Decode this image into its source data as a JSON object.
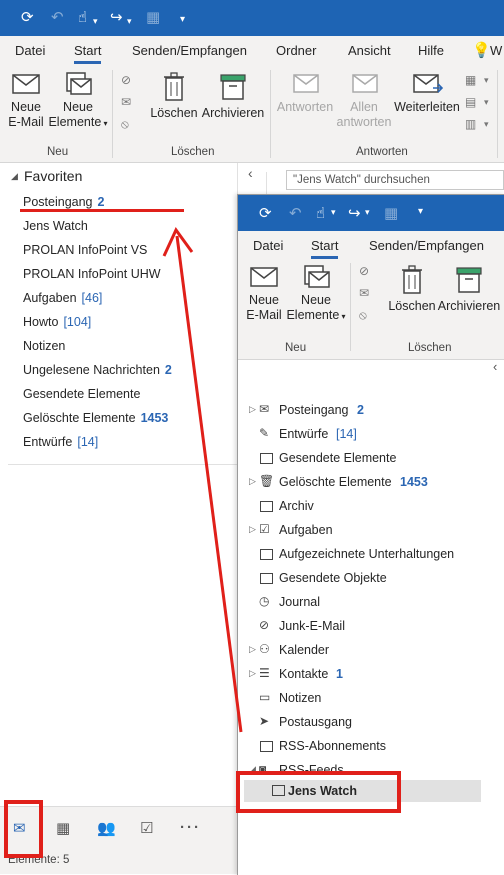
{
  "main": {
    "tabs": [
      "Datei",
      "Start",
      "Senden/Empfangen",
      "Ordner",
      "Ansicht",
      "Hilfe"
    ],
    "ribbon": {
      "new_email": "Neue\nE-Mail",
      "new_email_l1": "Neue",
      "new_email_l2": "E-Mail",
      "new_items_l1": "Neue",
      "new_items_l2": "Elemente",
      "delete": "Löschen",
      "archive": "Archivieren",
      "reply": "Antworten",
      "reply_all_l1": "Allen",
      "reply_all_l2": "antworten",
      "forward": "Weiterleiten",
      "group_new": "Neu",
      "group_delete": "Löschen",
      "group_reply": "Antworten"
    },
    "search_placeholder": "\"Jens Watch\" durchsuchen",
    "favorites_header": "Favoriten",
    "favorites": [
      {
        "label": "Posteingang",
        "count": "2",
        "count_style": "bold"
      },
      {
        "label": "Jens Watch",
        "count": "",
        "count_style": ""
      },
      {
        "label": "PROLAN InfoPoint VS",
        "count": "",
        "count_style": ""
      },
      {
        "label": "PROLAN InfoPoint UHW",
        "count": "",
        "count_style": ""
      },
      {
        "label": "Aufgaben",
        "count": "[46]",
        "count_style": "bracket"
      },
      {
        "label": "Howto",
        "count": "[104]",
        "count_style": "bracket"
      },
      {
        "label": "Notizen",
        "count": "",
        "count_style": ""
      },
      {
        "label": "Ungelesene Nachrichten",
        "count": "2",
        "count_style": "bold"
      },
      {
        "label": "Gesendete Elemente",
        "count": "",
        "count_style": ""
      },
      {
        "label": "Gelöschte Elemente",
        "count": "1453",
        "count_style": "bold"
      },
      {
        "label": "Entwürfe",
        "count": "[14]",
        "count_style": "bracket"
      }
    ],
    "status": "Elemente: 5"
  },
  "second": {
    "tabs": [
      "Datei",
      "Start",
      "Senden/Empfangen"
    ],
    "ribbon": {
      "new_email_l1": "Neue",
      "new_email_l2": "E-Mail",
      "new_items_l1": "Neue",
      "new_items_l2": "Elemente",
      "delete": "Löschen",
      "archive": "Archivieren",
      "group_new": "Neu",
      "group_delete": "Löschen"
    },
    "folders": [
      {
        "label": "Posteingang",
        "count": "2",
        "count_style": "bold",
        "icon": "mail-icon",
        "expander": true
      },
      {
        "label": "Entwürfe",
        "count": "[14]",
        "count_style": "bracket",
        "icon": "drafts-icon",
        "expander": false
      },
      {
        "label": "Gesendete Elemente",
        "count": "",
        "count_style": "",
        "icon": "folder-icon",
        "expander": false
      },
      {
        "label": "Gelöschte Elemente",
        "count": "1453",
        "count_style": "bold",
        "icon": "trash-icon",
        "expander": true
      },
      {
        "label": "Archiv",
        "count": "",
        "count_style": "",
        "icon": "folder-icon",
        "expander": false
      },
      {
        "label": "Aufgaben",
        "count": "",
        "count_style": "",
        "icon": "tasks-icon",
        "expander": true
      },
      {
        "label": "Aufgezeichnete Unterhaltungen",
        "count": "",
        "count_style": "",
        "icon": "folder-icon",
        "expander": false
      },
      {
        "label": "Gesendete Objekte",
        "count": "",
        "count_style": "",
        "icon": "folder-icon",
        "expander": false
      },
      {
        "label": "Journal",
        "count": "",
        "count_style": "",
        "icon": "journal-icon",
        "expander": false
      },
      {
        "label": "Junk-E-Mail",
        "count": "",
        "count_style": "",
        "icon": "junk-icon",
        "expander": false
      },
      {
        "label": "Kalender",
        "count": "",
        "count_style": "",
        "icon": "calendar-icon",
        "expander": true
      },
      {
        "label": "Kontakte",
        "count": "1",
        "count_style": "bold",
        "icon": "contacts-icon",
        "expander": true
      },
      {
        "label": "Notizen",
        "count": "",
        "count_style": "",
        "icon": "notes-icon",
        "expander": false
      },
      {
        "label": "Postausgang",
        "count": "",
        "count_style": "",
        "icon": "outbox-icon",
        "expander": false
      },
      {
        "label": "RSS-Abonnements",
        "count": "",
        "count_style": "",
        "icon": "folder-icon",
        "expander": false
      },
      {
        "label": "RSS-Feeds",
        "count": "",
        "count_style": "",
        "icon": "rss-icon",
        "expander": "open"
      }
    ],
    "selected_subfolder": "Jens Watch"
  },
  "colors": {
    "accent": "#1e64b4",
    "annotation": "#e0201a",
    "count": "#2b66b3"
  }
}
